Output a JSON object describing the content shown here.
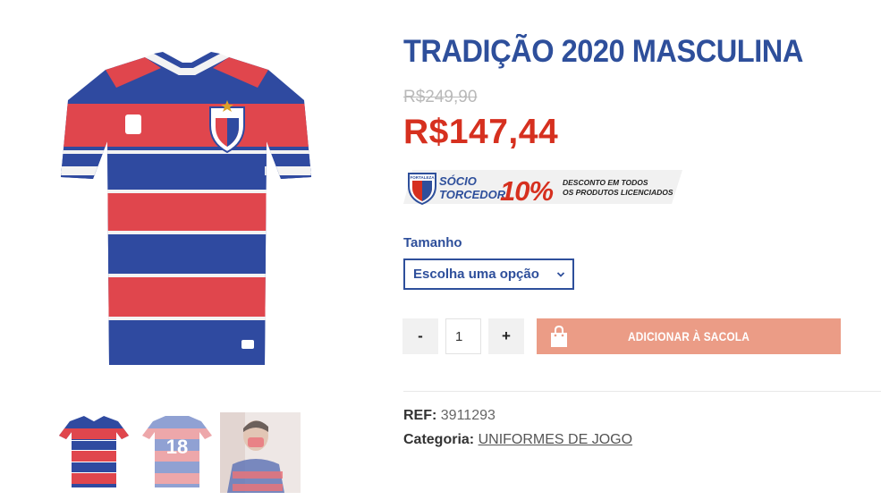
{
  "product": {
    "title": "TRADIÇÃO 2020 MASCULINA",
    "old_price": "R$249,90",
    "price": "R$147,44"
  },
  "promo_banner": {
    "socio_line1": "SÓCIO",
    "socio_line2": "TORCEDOR",
    "percent": "10%",
    "desc_line1": "DESCONTO EM TODOS",
    "desc_line2": "OS PRODUTOS LICENCIADOS",
    "logo_text": "FORTALEZA"
  },
  "variation": {
    "label": "Tamanho",
    "selected": "Escolha uma opção"
  },
  "cart": {
    "minus_label": "-",
    "plus_label": "+",
    "quantity": "1",
    "add_label": "ADICIONAR À SACOLA"
  },
  "meta": {
    "ref_label": "REF:",
    "ref_value": "3911293",
    "category_label": "Categoria:",
    "category_value": "UNIFORMES DE JOGO"
  },
  "thumbnails": {
    "back_number": "18"
  },
  "colors": {
    "brand_blue": "#2e4f9b",
    "price_red": "#d6301f",
    "add_button": "#eb9c86"
  }
}
